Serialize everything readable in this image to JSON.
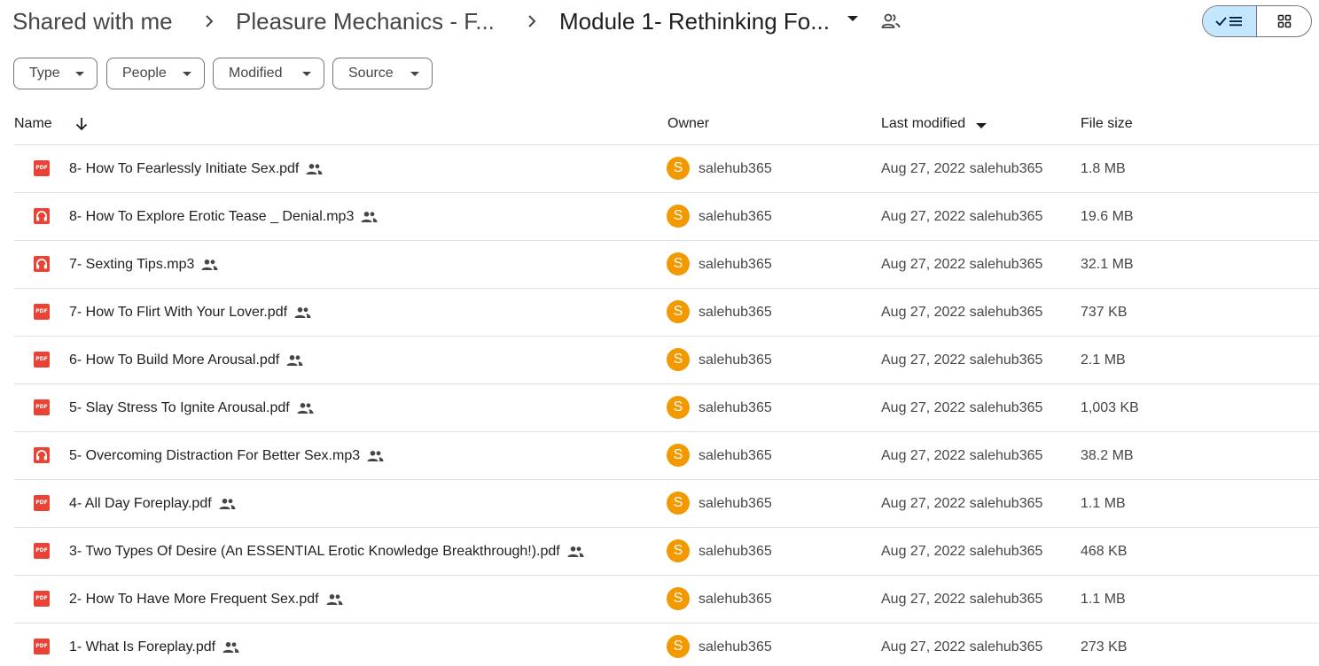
{
  "breadcrumb": {
    "items": [
      "Shared with me",
      "Pleasure Mechanics - F...",
      "Module 1- Rethinking Fo..."
    ]
  },
  "view": {
    "list_selected": true
  },
  "filters": [
    "Type",
    "People",
    "Modified",
    "Source"
  ],
  "columns": {
    "name": "Name",
    "owner": "Owner",
    "modified": "Last modified",
    "size": "File size"
  },
  "files": [
    {
      "type": "pdf",
      "name": "8- How To Fearlessly Initiate Sex.pdf",
      "owner_initial": "S",
      "owner": "salehub365",
      "modified": "Aug 27, 2022 salehub365",
      "size": "1.8 MB"
    },
    {
      "type": "audio",
      "name": "8- How To Explore Erotic Tease _ Denial.mp3",
      "owner_initial": "S",
      "owner": "salehub365",
      "modified": "Aug 27, 2022 salehub365",
      "size": "19.6 MB"
    },
    {
      "type": "audio",
      "name": "7- Sexting Tips.mp3",
      "owner_initial": "S",
      "owner": "salehub365",
      "modified": "Aug 27, 2022 salehub365",
      "size": "32.1 MB"
    },
    {
      "type": "pdf",
      "name": "7- How To Flirt With Your Lover.pdf",
      "owner_initial": "S",
      "owner": "salehub365",
      "modified": "Aug 27, 2022 salehub365",
      "size": "737 KB"
    },
    {
      "type": "pdf",
      "name": "6- How To Build More Arousal.pdf",
      "owner_initial": "S",
      "owner": "salehub365",
      "modified": "Aug 27, 2022 salehub365",
      "size": "2.1 MB"
    },
    {
      "type": "pdf",
      "name": "5- Slay Stress To Ignite Arousal.pdf",
      "owner_initial": "S",
      "owner": "salehub365",
      "modified": "Aug 27, 2022 salehub365",
      "size": "1,003 KB"
    },
    {
      "type": "audio",
      "name": "5- Overcoming Distraction For Better Sex.mp3",
      "owner_initial": "S",
      "owner": "salehub365",
      "modified": "Aug 27, 2022 salehub365",
      "size": "38.2 MB"
    },
    {
      "type": "pdf",
      "name": "4- All Day Foreplay.pdf",
      "owner_initial": "S",
      "owner": "salehub365",
      "modified": "Aug 27, 2022 salehub365",
      "size": "1.1 MB"
    },
    {
      "type": "pdf",
      "name": "3- Two Types Of Desire (An ESSENTIAL Erotic Knowledge Breakthrough!).pdf",
      "owner_initial": "S",
      "owner": "salehub365",
      "modified": "Aug 27, 2022 salehub365",
      "size": "468 KB"
    },
    {
      "type": "pdf",
      "name": "2- How To Have More Frequent Sex.pdf",
      "owner_initial": "S",
      "owner": "salehub365",
      "modified": "Aug 27, 2022 salehub365",
      "size": "1.1 MB"
    },
    {
      "type": "pdf",
      "name": "1-  What Is Foreplay.pdf",
      "owner_initial": "S",
      "owner": "salehub365",
      "modified": "Aug 27, 2022 salehub365",
      "size": "273 KB"
    }
  ],
  "colors": {
    "pdf_red": "#ea4335",
    "avatar_orange": "#f29900",
    "selected_toggle": "#c2e7ff"
  },
  "icons": {
    "shared": "people-icon",
    "pdf": "pdf-file-icon",
    "audio": "headphones-icon",
    "sort": "arrow-down-icon"
  }
}
